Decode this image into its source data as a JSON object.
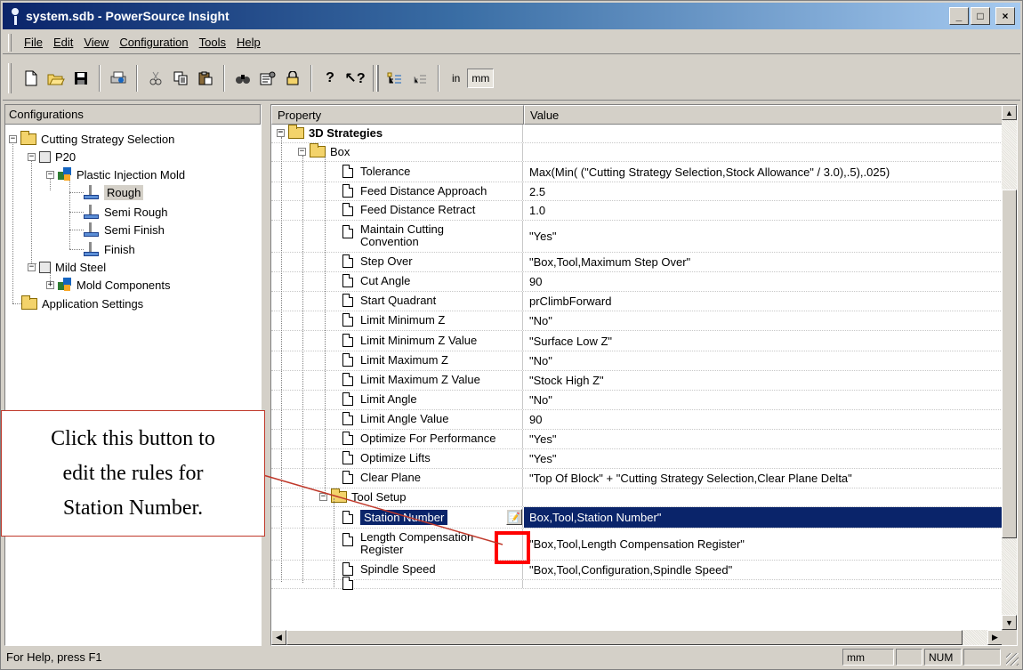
{
  "window": {
    "title": "system.sdb - PowerSource Insight",
    "buttons": {
      "minimize": "_",
      "maximize": "□",
      "close": "×"
    }
  },
  "menu": [
    {
      "label": "File"
    },
    {
      "label": "Edit"
    },
    {
      "label": "View"
    },
    {
      "label": "Configuration"
    },
    {
      "label": "Tools"
    },
    {
      "label": "Help"
    }
  ],
  "toolbar": {
    "buttons": [
      "new-document",
      "open-folder",
      "save-disk",
      "print",
      "cut",
      "copy",
      "paste",
      "find",
      "properties",
      "lock",
      "help",
      "context-help",
      "expand-tree",
      "collapse-tree"
    ],
    "unit_in": "in",
    "unit_mm": "mm"
  },
  "left_pane": {
    "header": "Configurations",
    "tree": {
      "cutting_strategy": "Cutting Strategy Selection",
      "p20": "P20",
      "plastic_mold": "Plastic Injection Mold",
      "rough": "Rough",
      "semi_rough": "Semi Rough",
      "semi_finish": "Semi Finish",
      "finish": "Finish",
      "mild_steel": "Mild Steel",
      "mold_components": "Mold Components",
      "app_settings": "Application Settings"
    }
  },
  "right_pane": {
    "headers": {
      "property": "Property",
      "value": "Value"
    },
    "strategies": "3D Strategies",
    "box": "Box",
    "rows": [
      {
        "property": "Tolerance",
        "value": "Max(Min( (\"Cutting Strategy Selection,Stock Allowance\" / 3.0),.5),.025)"
      },
      {
        "property": "Feed Distance Approach",
        "value": "2.5"
      },
      {
        "property": "Feed Distance Retract",
        "value": "1.0"
      },
      {
        "property": "Maintain Cutting\nConvention",
        "value": "\"Yes\""
      },
      {
        "property": "Step Over",
        "value": " \"Box,Tool,Maximum Step Over\""
      },
      {
        "property": "Cut Angle",
        "value": "90"
      },
      {
        "property": "Start Quadrant",
        "value": "prClimbForward"
      },
      {
        "property": "Limit Minimum Z",
        "value": "\"No\""
      },
      {
        "property": "Limit Minimum Z Value",
        "value": " \"Surface Low Z\""
      },
      {
        "property": "Limit Maximum Z",
        "value": "\"No\""
      },
      {
        "property": "Limit Maximum Z Value",
        "value": " \"Stock High Z\""
      },
      {
        "property": "Limit Angle",
        "value": "\"No\""
      },
      {
        "property": "Limit Angle Value",
        "value": "90"
      },
      {
        "property": "Optimize For Performance",
        "value": "\"Yes\""
      },
      {
        "property": "Optimize Lifts",
        "value": "\"Yes\""
      },
      {
        "property": "Clear Plane",
        "value": "\"Top Of Block\" + \"Cutting Strategy Selection,Clear Plane Delta\""
      }
    ],
    "tool_setup": "Tool Setup",
    "tool_rows": [
      {
        "property": "Station Number",
        "value": "Box,Tool,Station Number\""
      },
      {
        "property": "Length Compensation\nRegister",
        "value": "\"Box,Tool,Length Compensation Register\""
      },
      {
        "property": "Spindle Speed",
        "value": "\"Box,Tool,Configuration,Spindle Speed\""
      }
    ]
  },
  "status": {
    "help": "For Help, press F1",
    "units": "mm",
    "num": "NUM"
  },
  "callout": {
    "text": "Click this button to\nedit the rules for\nStation Number."
  },
  "colors": {
    "selection": "#0a246a",
    "highlight_box": "#ff0000",
    "callout_border": "#c0392b"
  }
}
